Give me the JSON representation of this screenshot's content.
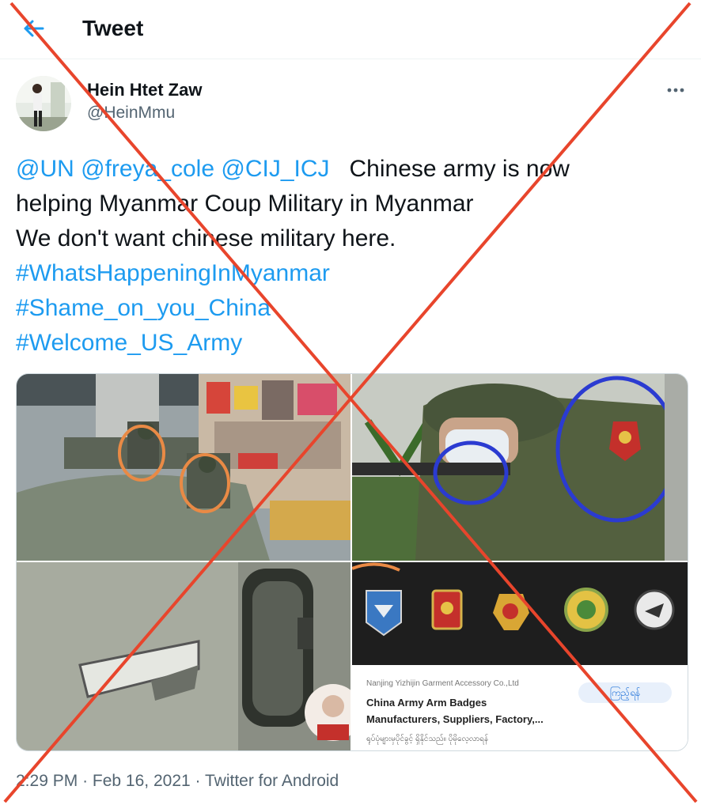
{
  "header": {
    "title": "Tweet",
    "back_icon": "arrow-left-icon"
  },
  "user": {
    "display_name": "Hein Htet Zaw",
    "handle": "@HeinMmu"
  },
  "tweet": {
    "mentions": [
      "@UN",
      "@freya_cole",
      "@CIJ_ICJ"
    ],
    "line1_text": "Chinese army is now",
    "line2_text": "helping Myanmar Coup Military in Myanmar",
    "line3_text": "We don't want chinese military here.",
    "hashtags": [
      "#WhatsHappeningInMyanmar",
      "#Shame_on_you_China",
      "#Welcome_US_Army"
    ]
  },
  "media": {
    "screenshot": {
      "seller": "Nanjing Yizhijin Garment Accessory Co.,Ltd",
      "title_line1": "China Army Arm Badges",
      "title_line2": "Manufacturers, Suppliers, Factory,...",
      "burmese_caption": "ရုပ်ပုံများမှပိုင်ခွင့် ရှိနိုင်သည်။ ပိုမိုလေ့လာရန်",
      "button_label": "ကြည့်ရန်"
    }
  },
  "footer": {
    "time": "2:29 PM",
    "date": "Feb 16, 2021",
    "source": "Twitter for Android",
    "separator": "·"
  },
  "colors": {
    "link": "#1d9bf0",
    "secondary_text": "#536471",
    "overlay_x": "#e8452c"
  }
}
